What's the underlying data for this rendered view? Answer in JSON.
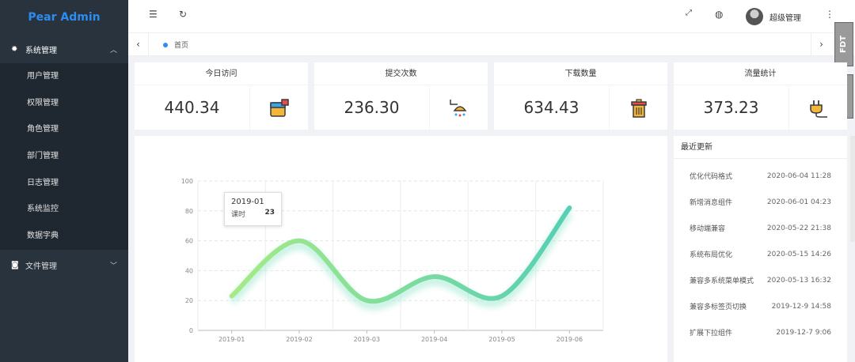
{
  "app": {
    "title": "Pear Admin"
  },
  "sidebar": {
    "group1": {
      "label": "系统管理",
      "icon": "gear-icon"
    },
    "items": [
      {
        "label": "用户管理"
      },
      {
        "label": "权限管理"
      },
      {
        "label": "角色管理"
      },
      {
        "label": "部门管理"
      },
      {
        "label": "日志管理"
      },
      {
        "label": "系统监控"
      },
      {
        "label": "数据字典"
      }
    ],
    "group2": {
      "label": "文件管理",
      "icon": "camera-icon"
    }
  },
  "header": {
    "user_name": "超级管理",
    "icons": [
      "menu-fold-icon",
      "refresh-icon",
      "fullscreen-icon",
      "globe-icon",
      "more-icon"
    ]
  },
  "tabs": {
    "home": "首页"
  },
  "badges": [
    "FDT",
    "FDT"
  ],
  "stats": [
    {
      "title": "今日访问",
      "value": "440.34",
      "icon": "paint-bucket-icon"
    },
    {
      "title": "提交次数",
      "value": "236.30",
      "icon": "shower-icon"
    },
    {
      "title": "下载数量",
      "value": "634.43",
      "icon": "trash-can-icon"
    },
    {
      "title": "流量统计",
      "value": "373.23",
      "icon": "plug-icon"
    }
  ],
  "chart_data": {
    "type": "line",
    "categories": [
      "2019-01",
      "2019-02",
      "2019-03",
      "2019-04",
      "2019-05",
      "2019-06"
    ],
    "series": [
      {
        "values": [
          23,
          60,
          20,
          36,
          23,
          82
        ]
      }
    ],
    "ylim": [
      0,
      100
    ],
    "yticks": [
      0,
      20,
      40,
      60,
      80,
      100
    ],
    "smooth": true,
    "colors": [
      "#a0e685",
      "#5bd1b4"
    ],
    "tooltip": {
      "title": "2019-01",
      "label": "课时",
      "value": "23"
    }
  },
  "updates": {
    "title": "最近更新",
    "items": [
      {
        "text": "优化代码格式",
        "time": "2020-06-04 11:28"
      },
      {
        "text": "新增消息组件",
        "time": "2020-06-01 04:23"
      },
      {
        "text": "移动端兼容",
        "time": "2020-05-22 21:38"
      },
      {
        "text": "系统布局优化",
        "time": "2020-05-15 14:26"
      },
      {
        "text": "兼容多系统菜单模式",
        "time": "2020-05-13 16:32"
      },
      {
        "text": "兼容多标签页切换",
        "time": "2019-12-9 14:58"
      },
      {
        "text": "扩展下拉组件",
        "time": "2019-12-7 9:06"
      }
    ]
  }
}
